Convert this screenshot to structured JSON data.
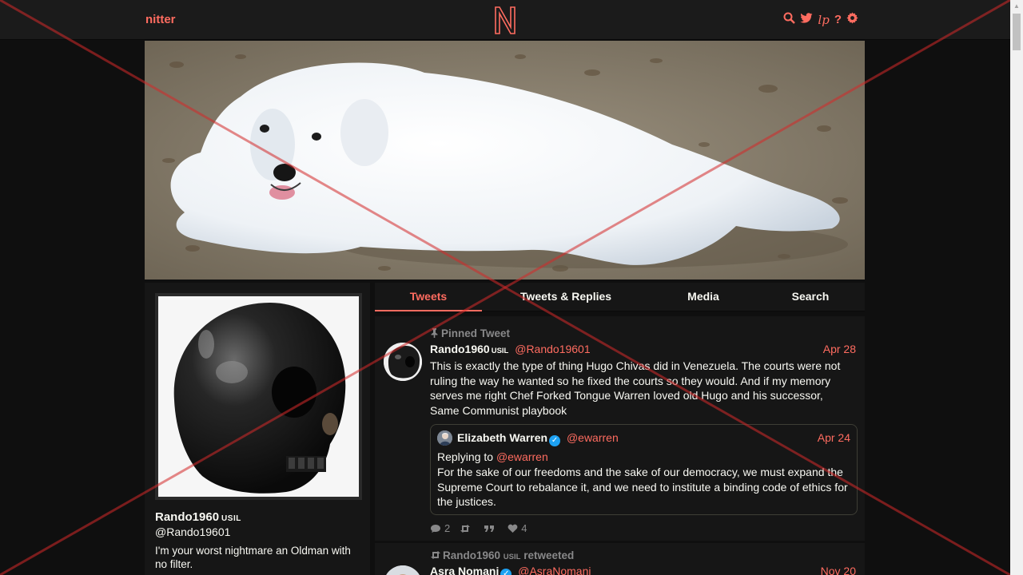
{
  "navbar": {
    "brand": "nitter",
    "logo_letter": "N",
    "icons": [
      "search-icon",
      "twitter-icon",
      "lp-icon",
      "help-icon",
      "gear-icon"
    ],
    "rss_glyph": "lp",
    "help_glyph": "?"
  },
  "profile": {
    "name": "Rando1960",
    "badge": "USIL",
    "handle": "@Rando19601",
    "bio": "I'm your worst nightmare an Oldman with no filter."
  },
  "tabs": [
    {
      "label": "Tweets",
      "active": true
    },
    {
      "label": "Tweets & Replies",
      "active": false
    },
    {
      "label": "Media",
      "active": false
    },
    {
      "label": "Search",
      "active": false
    }
  ],
  "tweets": [
    {
      "header": "Pinned Tweet",
      "name": "Rando1960",
      "badge": "USIL",
      "handle": "@Rando19601",
      "date": "Apr 28",
      "text": "This is exactly the type of thing Hugo Chivas did in Venezuela. The courts were not ruling the way he wanted so he fixed the courts so they would. And if my memory serves me  right Chef Forked Tongue Warren loved old Hugo and his successor, Same Communist playbook",
      "quote": {
        "name": "Elizabeth Warren",
        "handle": "@ewarren",
        "date": "Apr 24",
        "replying_label": "Replying to",
        "replying_handle": "@ewarren",
        "text": "For the sake of our freedoms and the sake of our democracy, we must expand the Supreme Court to rebalance it, and we need to institute a binding code of ethics for the justices."
      },
      "stats": {
        "replies": "2",
        "retweets": "",
        "quotes": "",
        "likes": "4"
      }
    },
    {
      "header_name": "Rando1960",
      "header_badge": "USIL",
      "header_action": "retweeted",
      "name": "Asra Nomani",
      "handle": "@AsraNomani",
      "date": "Nov 20"
    }
  ],
  "colors": {
    "accent": "#ff6c60",
    "background": "#0f0f0f",
    "panel": "#161616",
    "muted": "#888889"
  }
}
